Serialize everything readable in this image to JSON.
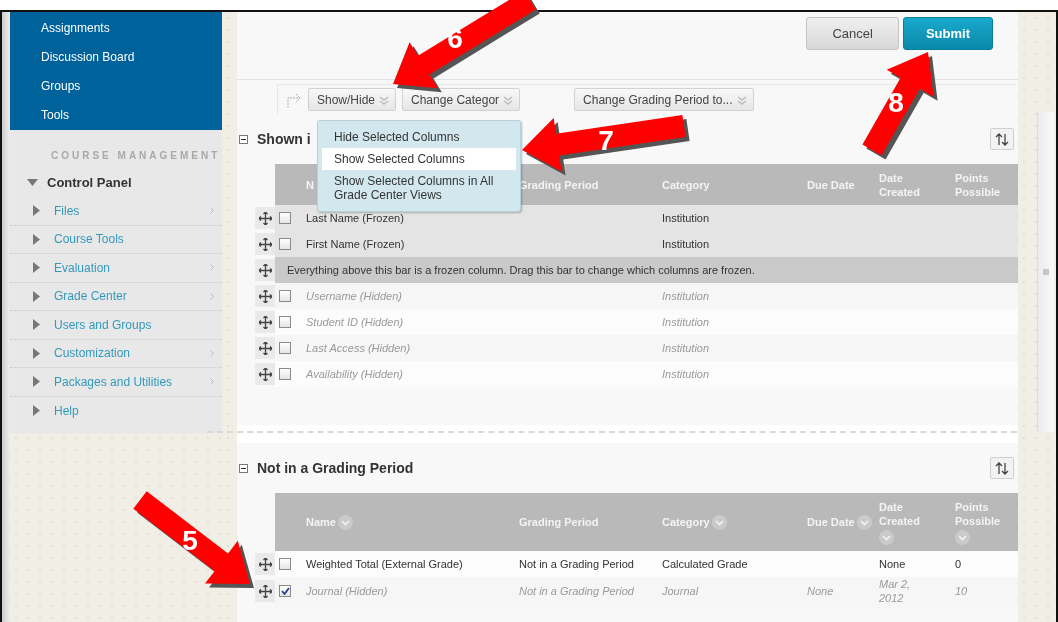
{
  "sidebar": {
    "course_items": [
      {
        "label": "Assignments"
      },
      {
        "label": "Discussion Board"
      },
      {
        "label": "Groups"
      },
      {
        "label": "Tools"
      }
    ],
    "management_heading": "COURSE MANAGEMENT",
    "control_panel": {
      "label": "Control Panel",
      "expanded": true,
      "items": [
        {
          "label": "Files",
          "expanded": false,
          "submenu": true
        },
        {
          "label": "Course Tools",
          "expanded": false,
          "submenu": false
        },
        {
          "label": "Evaluation",
          "expanded": false,
          "submenu": true
        },
        {
          "label": "Grade Center",
          "expanded": false,
          "submenu": true
        },
        {
          "label": "Users and Groups",
          "expanded": false,
          "submenu": false
        },
        {
          "label": "Customization",
          "expanded": false,
          "submenu": true
        },
        {
          "label": "Packages and Utilities",
          "expanded": false,
          "submenu": true
        },
        {
          "label": "Help",
          "expanded": false,
          "submenu": false
        }
      ]
    }
  },
  "buttons": [
    {
      "label": "Cancel",
      "kind": "secondary"
    },
    {
      "label": "Submit",
      "kind": "primary"
    }
  ],
  "toolbar": [
    {
      "label": "Show/Hide"
    },
    {
      "label": "Change Categor"
    },
    {
      "label": "Change Grading Period to..."
    }
  ],
  "dropdown": [
    {
      "label": "Hide Selected Columns",
      "selected": false
    },
    {
      "label": "Show Selected Columns",
      "selected": true
    },
    {
      "label": "Show Selected Columns in All Grade Center Views",
      "selected": false
    }
  ],
  "sections": [
    {
      "title": "Shown i",
      "expanded": true,
      "columns": [
        {
          "label": "N",
          "sortable": false
        },
        {
          "label": "Grading Period",
          "sortable": false
        },
        {
          "label": "Category",
          "sortable": false
        },
        {
          "label": "Due Date",
          "sortable": false
        },
        {
          "label": "Date Created",
          "sortable": false
        },
        {
          "label": "Points Possible",
          "sortable": false
        }
      ],
      "rows": [
        {
          "kind": "column",
          "checked": false,
          "hidden": false,
          "frozen": true,
          "cells": [
            "Last Name (Frozen)",
            "",
            "Institution",
            "",
            "",
            ""
          ]
        },
        {
          "kind": "column",
          "checked": false,
          "hidden": false,
          "frozen": true,
          "cells": [
            "First Name (Frozen)",
            "",
            "Institution",
            "",
            "",
            ""
          ]
        },
        {
          "kind": "frozen_bar",
          "text": "Everything above this bar is a frozen column. Drag this bar to change which columns are frozen."
        },
        {
          "kind": "column",
          "checked": false,
          "hidden": true,
          "frozen": false,
          "cells": [
            "Username (Hidden)",
            "",
            "Institution",
            "",
            "",
            ""
          ]
        },
        {
          "kind": "column",
          "checked": false,
          "hidden": true,
          "frozen": false,
          "cells": [
            "Student ID (Hidden)",
            "",
            "Institution",
            "",
            "",
            ""
          ]
        },
        {
          "kind": "column",
          "checked": false,
          "hidden": true,
          "frozen": false,
          "cells": [
            "Last Access (Hidden)",
            "",
            "Institution",
            "",
            "",
            ""
          ]
        },
        {
          "kind": "column",
          "checked": false,
          "hidden": true,
          "frozen": false,
          "cells": [
            "Availability (Hidden)",
            "",
            "Institution",
            "",
            "",
            ""
          ]
        }
      ]
    },
    {
      "title": "Not in a Grading Period",
      "expanded": true,
      "columns": [
        {
          "label": "Name",
          "sortable": true
        },
        {
          "label": "Grading Period",
          "sortable": false
        },
        {
          "label": "Category",
          "sortable": true
        },
        {
          "label": "Due Date",
          "sortable": true
        },
        {
          "label": "Date Created",
          "sortable": true
        },
        {
          "label": "Points Possible",
          "sortable": true
        }
      ],
      "rows": [
        {
          "kind": "column",
          "checked": false,
          "hidden": false,
          "frozen": false,
          "cells": [
            "Weighted Total (External Grade)",
            "Not in a Grading Period",
            "Calculated Grade",
            "",
            "None",
            "0"
          ]
        },
        {
          "kind": "column",
          "checked": true,
          "hidden": true,
          "frozen": false,
          "cells": [
            "Journal (Hidden)",
            "Not in a Grading Period",
            "Journal",
            "None",
            "Mar 2, 2012",
            "10"
          ]
        }
      ]
    }
  ],
  "callouts": [
    {
      "number": "6"
    },
    {
      "number": "7"
    },
    {
      "number": "8"
    },
    {
      "number": "5"
    }
  ]
}
